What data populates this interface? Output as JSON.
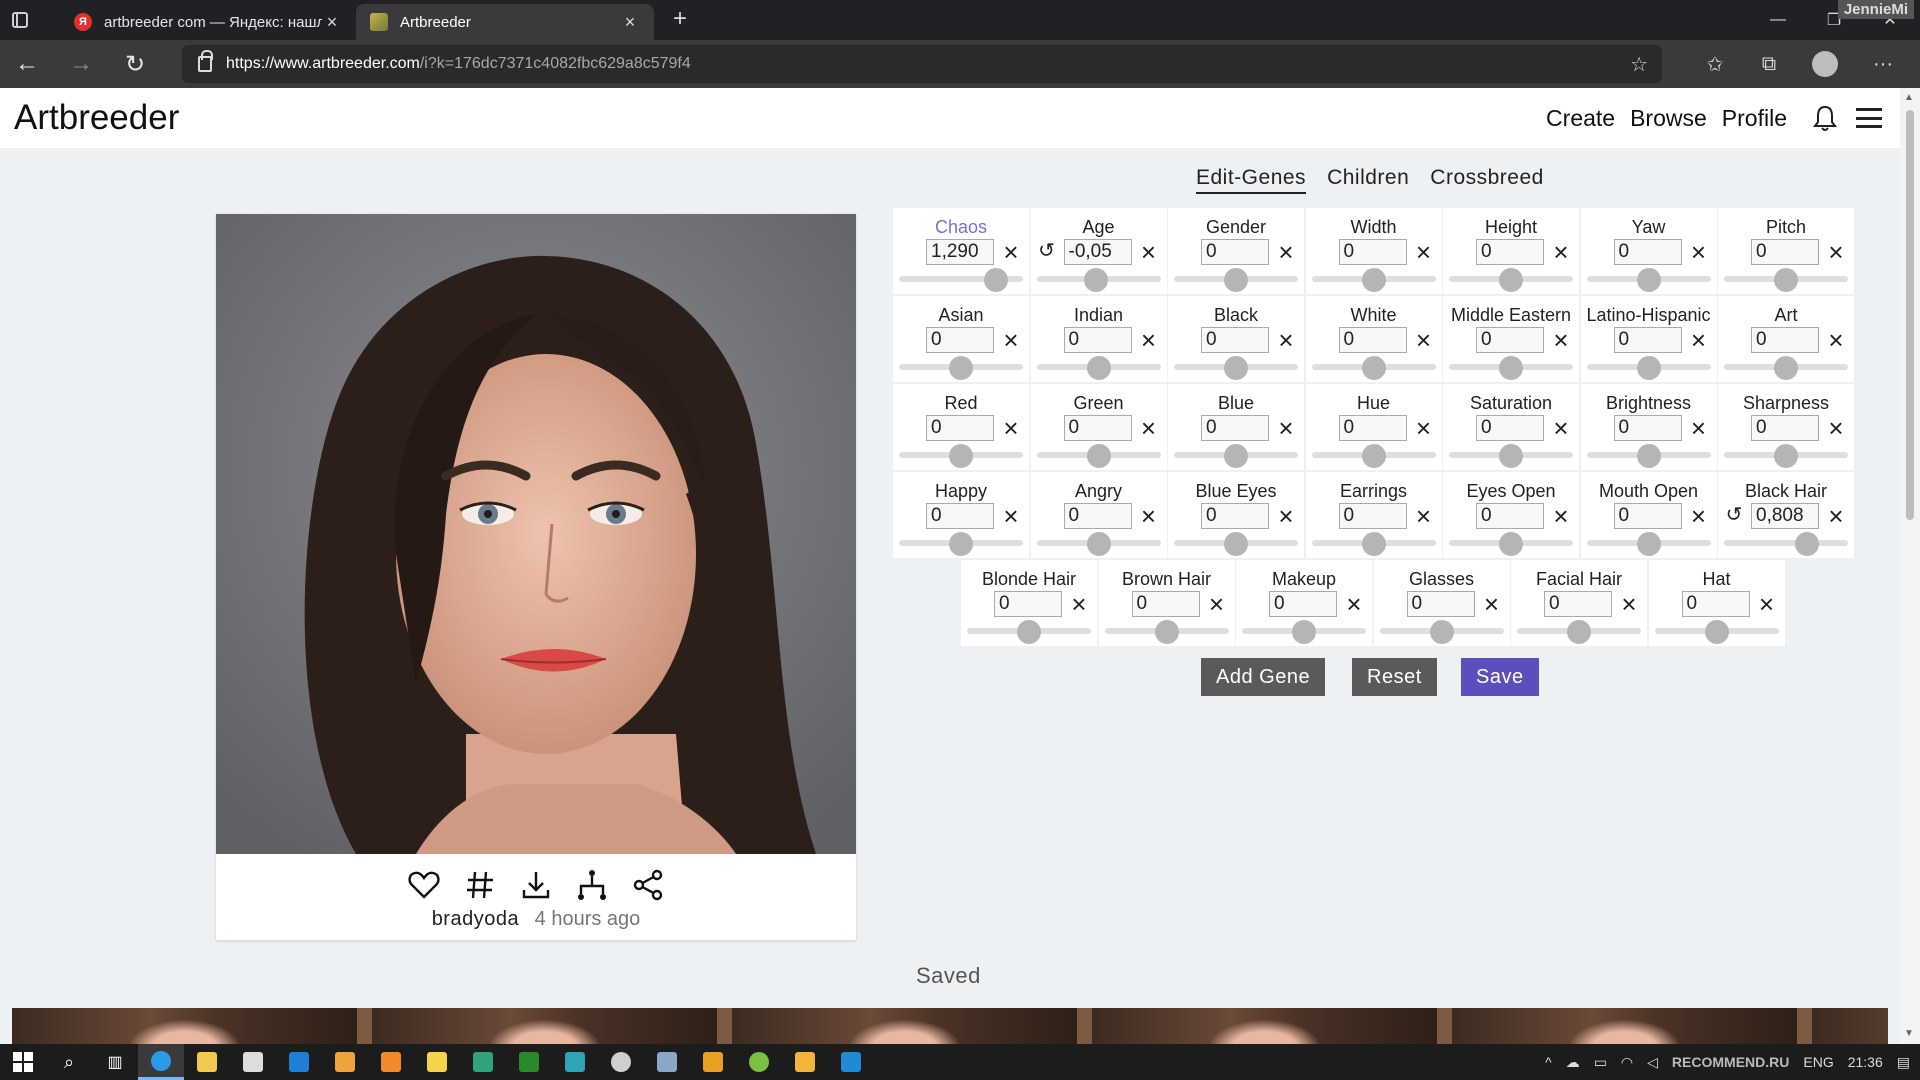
{
  "browser": {
    "tabs": [
      {
        "title": "artbreeder com — Яндекс: нашл",
        "favicon_letter": "Я"
      },
      {
        "title": "Artbreeder"
      }
    ],
    "window_user_badge": "JennieMi",
    "url_domain": "https://www.artbreeder.com",
    "url_rest": "/i?k=176dc7371c4082fbc629a8c579f4"
  },
  "site": {
    "brand": "Artbreeder",
    "nav": {
      "create": "Create",
      "browse": "Browse",
      "profile": "Profile"
    }
  },
  "card": {
    "author": "bradyoda",
    "time": "4 hours ago",
    "actions": [
      "heart-icon",
      "hash-icon",
      "download-icon",
      "tree-icon",
      "share-icon"
    ]
  },
  "gene_tabs": [
    "Edit-Genes",
    "Children",
    "Crossbreed"
  ],
  "genes": {
    "row1": [
      {
        "name": "Chaos",
        "value": "1,290",
        "level": 0.78,
        "highlight": true,
        "resettable": false
      },
      {
        "name": "Age",
        "value": "-0,05",
        "level": 0.48,
        "resettable": true
      },
      {
        "name": "Gender",
        "value": "0",
        "level": 0.5
      },
      {
        "name": "Width",
        "value": "0",
        "level": 0.5
      },
      {
        "name": "Height",
        "value": "0",
        "level": 0.5
      },
      {
        "name": "Yaw",
        "value": "0",
        "level": 0.5
      },
      {
        "name": "Pitch",
        "value": "0",
        "level": 0.5
      }
    ],
    "row2": [
      {
        "name": "Asian",
        "value": "0",
        "level": 0.5
      },
      {
        "name": "Indian",
        "value": "0",
        "level": 0.5
      },
      {
        "name": "Black",
        "value": "0",
        "level": 0.5
      },
      {
        "name": "White",
        "value": "0",
        "level": 0.5
      },
      {
        "name": "Middle Eastern",
        "value": "0",
        "level": 0.5
      },
      {
        "name": "Latino-Hispanic",
        "value": "0",
        "level": 0.5
      },
      {
        "name": "Art",
        "value": "0",
        "level": 0.5
      }
    ],
    "row3": [
      {
        "name": "Red",
        "value": "0",
        "level": 0.5
      },
      {
        "name": "Green",
        "value": "0",
        "level": 0.5
      },
      {
        "name": "Blue",
        "value": "0",
        "level": 0.5
      },
      {
        "name": "Hue",
        "value": "0",
        "level": 0.5
      },
      {
        "name": "Saturation",
        "value": "0",
        "level": 0.5
      },
      {
        "name": "Brightness",
        "value": "0",
        "level": 0.5
      },
      {
        "name": "Sharpness",
        "value": "0",
        "level": 0.5
      }
    ],
    "row4": [
      {
        "name": "Happy",
        "value": "0",
        "level": 0.5
      },
      {
        "name": "Angry",
        "value": "0",
        "level": 0.5
      },
      {
        "name": "Blue Eyes",
        "value": "0",
        "level": 0.5
      },
      {
        "name": "Earrings",
        "value": "0",
        "level": 0.5
      },
      {
        "name": "Eyes Open",
        "value": "0",
        "level": 0.5
      },
      {
        "name": "Mouth Open",
        "value": "0",
        "level": 0.5
      },
      {
        "name": "Black Hair",
        "value": "0,808",
        "level": 0.67,
        "resettable": true
      }
    ],
    "row5": [
      {
        "name": "Blonde Hair",
        "value": "0",
        "level": 0.5
      },
      {
        "name": "Brown Hair",
        "value": "0",
        "level": 0.5
      },
      {
        "name": "Makeup",
        "value": "0",
        "level": 0.5
      },
      {
        "name": "Glasses",
        "value": "0",
        "level": 0.5
      },
      {
        "name": "Facial Hair",
        "value": "0",
        "level": 0.5
      },
      {
        "name": "Hat",
        "value": "0",
        "level": 0.5
      }
    ]
  },
  "buttons": {
    "add_gene": "Add Gene",
    "reset": "Reset",
    "save": "Save"
  },
  "status": "Saved",
  "colors": {
    "accent": "#5b4ebd",
    "chaos_label": "#7a6fd0",
    "button_grey": "#5a5a5a"
  },
  "taskbar": {
    "tray_lang": "ENG",
    "tray_time": "21:36",
    "watermark": "RECOMMEND.RU"
  }
}
